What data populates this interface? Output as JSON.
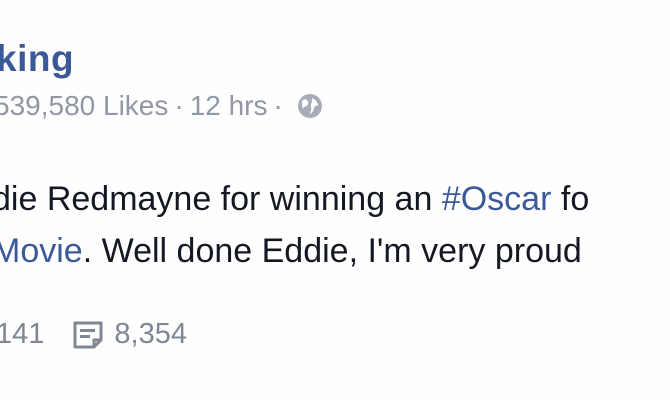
{
  "post": {
    "author": "king",
    "meta": {
      "likes": "539,580 Likes",
      "separator": "·",
      "time": "12 hrs",
      "audience_icon": "globe-icon"
    },
    "body": {
      "line1_text": "die Redmayne for winning an ",
      "line1_hashtag": "#Oscar",
      "line1_tail": " fo",
      "line2_hashtag": "Movie",
      "line2_text": ". Well done Eddie, I'm very proud"
    },
    "stats": {
      "shares": "141",
      "comments_icon": "comment-icon",
      "comments": "8,354"
    }
  },
  "colors": {
    "link": "#3b5998",
    "meta": "#9197a3",
    "body": "#141823"
  }
}
